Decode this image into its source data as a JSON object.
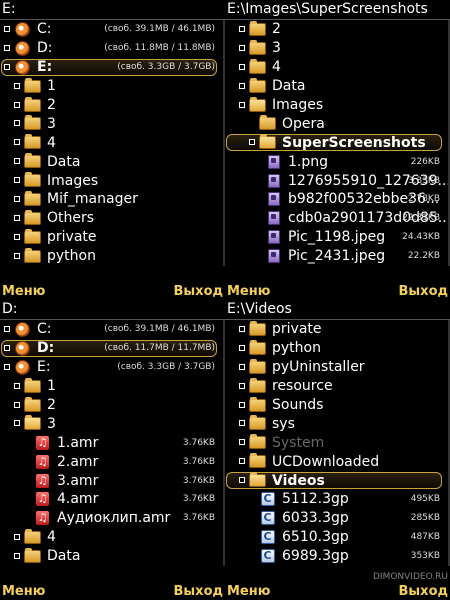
{
  "screens": [
    {
      "title": "E:",
      "softkeys": {
        "left": "Меню",
        "right": "Выход"
      },
      "rows": [
        {
          "indent": 0,
          "toggle": true,
          "icon": "drive-icon",
          "label": "C:",
          "meta": "(своб. 39.1MB / 46.1MB)",
          "selected": false
        },
        {
          "indent": 0,
          "toggle": true,
          "icon": "drive-icon",
          "label": "D:",
          "meta": "(своб. 11.8MB / 11.8MB)",
          "selected": false
        },
        {
          "indent": 0,
          "toggle": true,
          "icon": "drive-icon",
          "label": "E:",
          "meta": "(своб. 3.3GB / 3.7GB)",
          "selected": true
        },
        {
          "indent": 1,
          "toggle": true,
          "icon": "folder-icon",
          "label": "1",
          "meta": "",
          "selected": false
        },
        {
          "indent": 1,
          "toggle": true,
          "icon": "folder-icon",
          "label": "2",
          "meta": "",
          "selected": false
        },
        {
          "indent": 1,
          "toggle": true,
          "icon": "folder-icon",
          "label": "3",
          "meta": "",
          "selected": false
        },
        {
          "indent": 1,
          "toggle": true,
          "icon": "folder-icon",
          "label": "4",
          "meta": "",
          "selected": false
        },
        {
          "indent": 1,
          "toggle": true,
          "icon": "folder-icon",
          "label": "Data",
          "meta": "",
          "selected": false
        },
        {
          "indent": 1,
          "toggle": true,
          "icon": "folder-icon",
          "label": "Images",
          "meta": "",
          "selected": false
        },
        {
          "indent": 1,
          "toggle": true,
          "icon": "folder-icon",
          "label": "Mif_manager",
          "meta": "",
          "selected": false
        },
        {
          "indent": 1,
          "toggle": true,
          "icon": "folder-icon",
          "label": "Others",
          "meta": "",
          "selected": false
        },
        {
          "indent": 1,
          "toggle": true,
          "icon": "folder-icon",
          "label": "private",
          "meta": "",
          "selected": false
        },
        {
          "indent": 1,
          "toggle": true,
          "icon": "folder-icon",
          "label": "python",
          "meta": "",
          "selected": false
        }
      ]
    },
    {
      "title": "E:\\Images\\SuperScreenshots",
      "softkeys": {
        "left": "Меню",
        "right": "Выход"
      },
      "rows": [
        {
          "indent": 1,
          "toggle": true,
          "icon": "folder-icon",
          "label": "2",
          "meta": "",
          "selected": false
        },
        {
          "indent": 1,
          "toggle": true,
          "icon": "folder-icon",
          "label": "3",
          "meta": "",
          "selected": false
        },
        {
          "indent": 1,
          "toggle": true,
          "icon": "folder-icon",
          "label": "4",
          "meta": "",
          "selected": false
        },
        {
          "indent": 1,
          "toggle": true,
          "icon": "folder-icon",
          "label": "Data",
          "meta": "",
          "selected": false
        },
        {
          "indent": 1,
          "toggle": true,
          "icon": "folder-open-icon",
          "label": "Images",
          "meta": "",
          "selected": false
        },
        {
          "indent": 2,
          "toggle": false,
          "icon": "folder-icon",
          "label": "Opera",
          "meta": "",
          "selected": false
        },
        {
          "indent": 2,
          "toggle": true,
          "icon": "folder-open-icon",
          "label": "SuperScreenshots",
          "meta": "",
          "selected": true
        },
        {
          "indent": 3,
          "toggle": false,
          "icon": "image-file-icon",
          "label": "1.png",
          "meta": "226KB",
          "selected": false
        },
        {
          "indent": 3,
          "toggle": false,
          "icon": "image-file-icon",
          "label": "1276955910_127639...",
          "meta": "3.33KB",
          "selected": false
        },
        {
          "indent": 3,
          "toggle": false,
          "icon": "image-file-icon",
          "label": "b982f00532ebbe36...",
          "meta": "2.78KB",
          "selected": false
        },
        {
          "indent": 3,
          "toggle": false,
          "icon": "image-file-icon",
          "label": "cdb0a2901173d0d85...",
          "meta": "22.31KB",
          "selected": false
        },
        {
          "indent": 3,
          "toggle": false,
          "icon": "image-file-icon",
          "label": "Pic_1198.jpeg",
          "meta": "24.43KB",
          "selected": false
        },
        {
          "indent": 3,
          "toggle": false,
          "icon": "image-file-icon",
          "label": "Pic_2431.jpeg",
          "meta": "22.2KB",
          "selected": false
        }
      ]
    },
    {
      "title": "D:",
      "softkeys": {
        "left": "Меню",
        "right": "Выход"
      },
      "rows": [
        {
          "indent": 0,
          "toggle": true,
          "icon": "drive-icon",
          "label": "C:",
          "meta": "(своб. 39.1MB / 46.1MB)",
          "selected": false
        },
        {
          "indent": 0,
          "toggle": true,
          "icon": "drive-icon",
          "label": "D:",
          "meta": "(своб. 11.7MB / 11.7MB)",
          "selected": true
        },
        {
          "indent": 0,
          "toggle": true,
          "icon": "drive-icon",
          "label": "E:",
          "meta": "(своб. 3.3GB / 3.7GB)",
          "selected": false
        },
        {
          "indent": 1,
          "toggle": true,
          "icon": "folder-icon",
          "label": "1",
          "meta": "",
          "selected": false
        },
        {
          "indent": 1,
          "toggle": true,
          "icon": "folder-icon",
          "label": "2",
          "meta": "",
          "selected": false
        },
        {
          "indent": 1,
          "toggle": true,
          "icon": "folder-open-icon",
          "label": "3",
          "meta": "",
          "selected": false
        },
        {
          "indent": 2,
          "toggle": false,
          "icon": "audio-file-icon",
          "label": "1.amr",
          "meta": "3.76KB",
          "selected": false
        },
        {
          "indent": 2,
          "toggle": false,
          "icon": "audio-file-icon",
          "label": "2.amr",
          "meta": "3.76KB",
          "selected": false
        },
        {
          "indent": 2,
          "toggle": false,
          "icon": "audio-file-icon",
          "label": "3.amr",
          "meta": "3.76KB",
          "selected": false
        },
        {
          "indent": 2,
          "toggle": false,
          "icon": "audio-file-icon",
          "label": "4.amr",
          "meta": "3.76KB",
          "selected": false
        },
        {
          "indent": 2,
          "toggle": false,
          "icon": "audio-file-icon",
          "label": "Аудиоклип.amr",
          "meta": "3.76KB",
          "selected": false
        },
        {
          "indent": 1,
          "toggle": true,
          "icon": "folder-icon",
          "label": "4",
          "meta": "",
          "selected": false
        },
        {
          "indent": 1,
          "toggle": true,
          "icon": "folder-icon",
          "label": "Data",
          "meta": "",
          "selected": false
        }
      ]
    },
    {
      "title": "E:\\Videos",
      "softkeys": {
        "left": "Меню",
        "right": "Выход"
      },
      "watermark": "DIMONVIDEO.RU",
      "rows": [
        {
          "indent": 1,
          "toggle": true,
          "icon": "folder-icon",
          "label": "private",
          "meta": "",
          "selected": false
        },
        {
          "indent": 1,
          "toggle": true,
          "icon": "folder-icon",
          "label": "python",
          "meta": "",
          "selected": false
        },
        {
          "indent": 1,
          "toggle": true,
          "icon": "folder-icon",
          "label": "pyUninstaller",
          "meta": "",
          "selected": false
        },
        {
          "indent": 1,
          "toggle": true,
          "icon": "folder-icon",
          "label": "resource",
          "meta": "",
          "selected": false
        },
        {
          "indent": 1,
          "toggle": true,
          "icon": "folder-icon",
          "label": "Sounds",
          "meta": "",
          "selected": false
        },
        {
          "indent": 1,
          "toggle": true,
          "icon": "folder-icon",
          "label": "sys",
          "meta": "",
          "selected": false
        },
        {
          "indent": 1,
          "toggle": true,
          "icon": "folder-icon",
          "label": "System",
          "meta": "",
          "selected": false,
          "dim": true
        },
        {
          "indent": 1,
          "toggle": true,
          "icon": "folder-icon",
          "label": "UCDownloaded",
          "meta": "",
          "selected": false
        },
        {
          "indent": 1,
          "toggle": true,
          "icon": "folder-open-icon",
          "label": "Videos",
          "meta": "",
          "selected": true
        },
        {
          "indent": 2,
          "toggle": false,
          "icon": "video-file-icon",
          "label": "5112.3gp",
          "meta": "495KB",
          "selected": false
        },
        {
          "indent": 2,
          "toggle": false,
          "icon": "video-file-icon",
          "label": "6033.3gp",
          "meta": "285KB",
          "selected": false
        },
        {
          "indent": 2,
          "toggle": false,
          "icon": "video-file-icon",
          "label": "6510.3gp",
          "meta": "487KB",
          "selected": false
        },
        {
          "indent": 2,
          "toggle": false,
          "icon": "video-file-icon",
          "label": "6989.3gp",
          "meta": "353KB",
          "selected": false
        }
      ]
    }
  ],
  "colors": {
    "accent": "#f3cf5c",
    "selection_border": "#c8a23a",
    "background": "#000000"
  }
}
